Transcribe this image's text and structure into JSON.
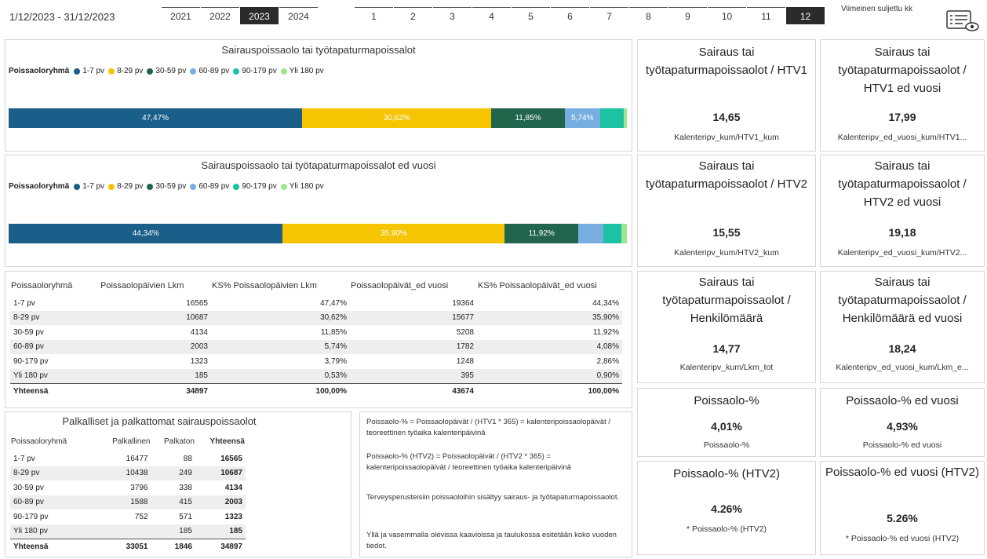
{
  "header": {
    "date_range": "1/12/2023 - 31/12/2023",
    "years": [
      "2021",
      "2022",
      "2023",
      "2024"
    ],
    "selected_year": "2023",
    "months": [
      "1",
      "2",
      "3",
      "4",
      "5",
      "6",
      "7",
      "8",
      "9",
      "10",
      "11",
      "12"
    ],
    "selected_month": "12",
    "last_closed_label": "Viimeinen suljettu kk"
  },
  "colors": {
    "c1": "#1a5f8a",
    "c2": "#f6c400",
    "c3": "#22654d",
    "c4": "#78aee0",
    "c5": "#1dc2a4",
    "c6": "#9de68b"
  },
  "legend": {
    "title": "Poissaoloryhmä",
    "items": [
      "1-7 pv",
      "8-29 pv",
      "30-59 pv",
      "60-89 pv",
      "90-179 pv",
      "Yli 180 pv"
    ]
  },
  "chart_data": [
    {
      "type": "bar",
      "title": "Sairauspoissaolo tai työtapaturmapoissalot",
      "categories": [
        "1-7 pv",
        "8-29 pv",
        "30-59 pv",
        "60-89 pv",
        "90-179 pv",
        "Yli 180 pv"
      ],
      "values": [
        47.47,
        30.62,
        11.85,
        5.74,
        3.79,
        0.53
      ],
      "labels": [
        "47,47%",
        "30,62%",
        "11,85%",
        "5,74%",
        "",
        ""
      ]
    },
    {
      "type": "bar",
      "title": "Sairauspoissaolo tai työtapaturmapoissalot ed vuosi",
      "categories": [
        "1-7 pv",
        "8-29 pv",
        "30-59 pv",
        "60-89 pv",
        "90-179 pv",
        "Yli 180 pv"
      ],
      "values": [
        44.34,
        35.9,
        11.92,
        4.08,
        2.86,
        0.9
      ],
      "labels": [
        "44,34%",
        "35,90%",
        "11,92%",
        "",
        "",
        ""
      ]
    }
  ],
  "main_table": {
    "headers": [
      "Poissaoloryhmä",
      "Poissaolopäivien Lkm",
      "KS% Poissaolopäivien Lkm",
      "Poissaolopäivät_ed vuosi",
      "KS% Poissaolopäivät_ed vuosi"
    ],
    "rows": [
      [
        "1-7 pv",
        "16565",
        "47,47%",
        "19364",
        "44,34%"
      ],
      [
        "8-29 pv",
        "10687",
        "30,62%",
        "15677",
        "35,90%"
      ],
      [
        "30-59 pv",
        "4134",
        "11,85%",
        "5208",
        "11,92%"
      ],
      [
        "60-89 pv",
        "2003",
        "5,74%",
        "1782",
        "4,08%"
      ],
      [
        "90-179 pv",
        "1323",
        "3,79%",
        "1248",
        "2,86%"
      ],
      [
        "Yli 180 pv",
        "185",
        "0,53%",
        "395",
        "0,90%"
      ]
    ],
    "total": [
      "Yhteensä",
      "34897",
      "100,00%",
      "43674",
      "100,00%"
    ]
  },
  "pay_table": {
    "title": "Palkalliset ja palkattomat sairauspoissaolot",
    "headers": [
      "Poissaoloryhmä",
      "Palkallinen",
      "Palkaton",
      "Yhteensä"
    ],
    "rows": [
      [
        "1-7 pv",
        "16477",
        "88",
        "16565"
      ],
      [
        "8-29 pv",
        "10438",
        "249",
        "10687"
      ],
      [
        "30-59 pv",
        "3796",
        "338",
        "4134"
      ],
      [
        "60-89 pv",
        "1588",
        "415",
        "2003"
      ],
      [
        "90-179 pv",
        "752",
        "571",
        "1323"
      ],
      [
        "Yli 180 pv",
        "",
        "185",
        "185"
      ]
    ],
    "total": [
      "Yhteensä",
      "33051",
      "1846",
      "34897"
    ]
  },
  "notes": {
    "p1": "Poissaolo-% = Poissaolopäivät / (HTV1 * 365) = kalenteripoissaolopäivät / teoreettinen työaika kalenteripäivinä",
    "p2": "Poissaolo-% (HTV2) = Poissaolopäivät / (HTV2 * 365) = kalenteripoissaolopäivät / teoreettinen työaika kalenteripäivinä",
    "p3": "Terveysperusteisiin poissaoloihin sisältyy sairaus- ja työtapaturmapoissaolot.",
    "p4": "Yllä ja vasemmalla olevissa kaavioissa ja taulukossa esitetään koko vuoden tiedot."
  },
  "kpis": {
    "htv1": {
      "title": "Sairaus tai työtapaturmapoissaolot / HTV1",
      "value": "14,65",
      "sub": "Kalenteripv_kum/HTV1_kum"
    },
    "htv1_prev": {
      "title": "Sairaus tai työtapaturmapoissaolot / HTV1 ed vuosi",
      "value": "17,99",
      "sub": "Kalenteripv_ed_vuosi_kum/HTV1..."
    },
    "htv2": {
      "title": "Sairaus tai työtapaturmapoissaolot / HTV2",
      "value": "15,55",
      "sub": "Kalenteripv_kum/HTV2_kum"
    },
    "htv2_prev": {
      "title": "Sairaus tai työtapaturmapoissaolot / HTV2 ed vuosi",
      "value": "19,18",
      "sub": "Kalenteripv_ed_vuosi_kum/HTV2..."
    },
    "hm": {
      "title": "Sairaus tai työtapaturmapoissaolot / Henkilömäärä",
      "value": "14,77",
      "sub": "Kalenteripv_kum/Lkm_tot"
    },
    "hm_prev": {
      "title": "Sairaus tai työtapaturmapoissaolot / Henkilömäärä ed vuosi",
      "value": "18,24",
      "sub": "Kalenteripv_ed_vuosi_kum/Lkm_e..."
    },
    "pct": {
      "title": "Poissaolo-%",
      "value": "4,01%",
      "sub": "Poissaolo-%"
    },
    "pct_prev": {
      "title": "Poissaolo-% ed vuosi",
      "value": "4,93%",
      "sub": "Poissaolo-% ed vuosi"
    },
    "pct2": {
      "title": "Poissaolo-% (HTV2)",
      "value": "4.26%",
      "sub": "* Poissaolo-% (HTV2)"
    },
    "pct2_prev": {
      "title": "Poissaolo-% ed vuosi (HTV2)",
      "value": "5.26%",
      "sub": "* Poissaolo-% ed vuosi (HTV2)"
    }
  }
}
